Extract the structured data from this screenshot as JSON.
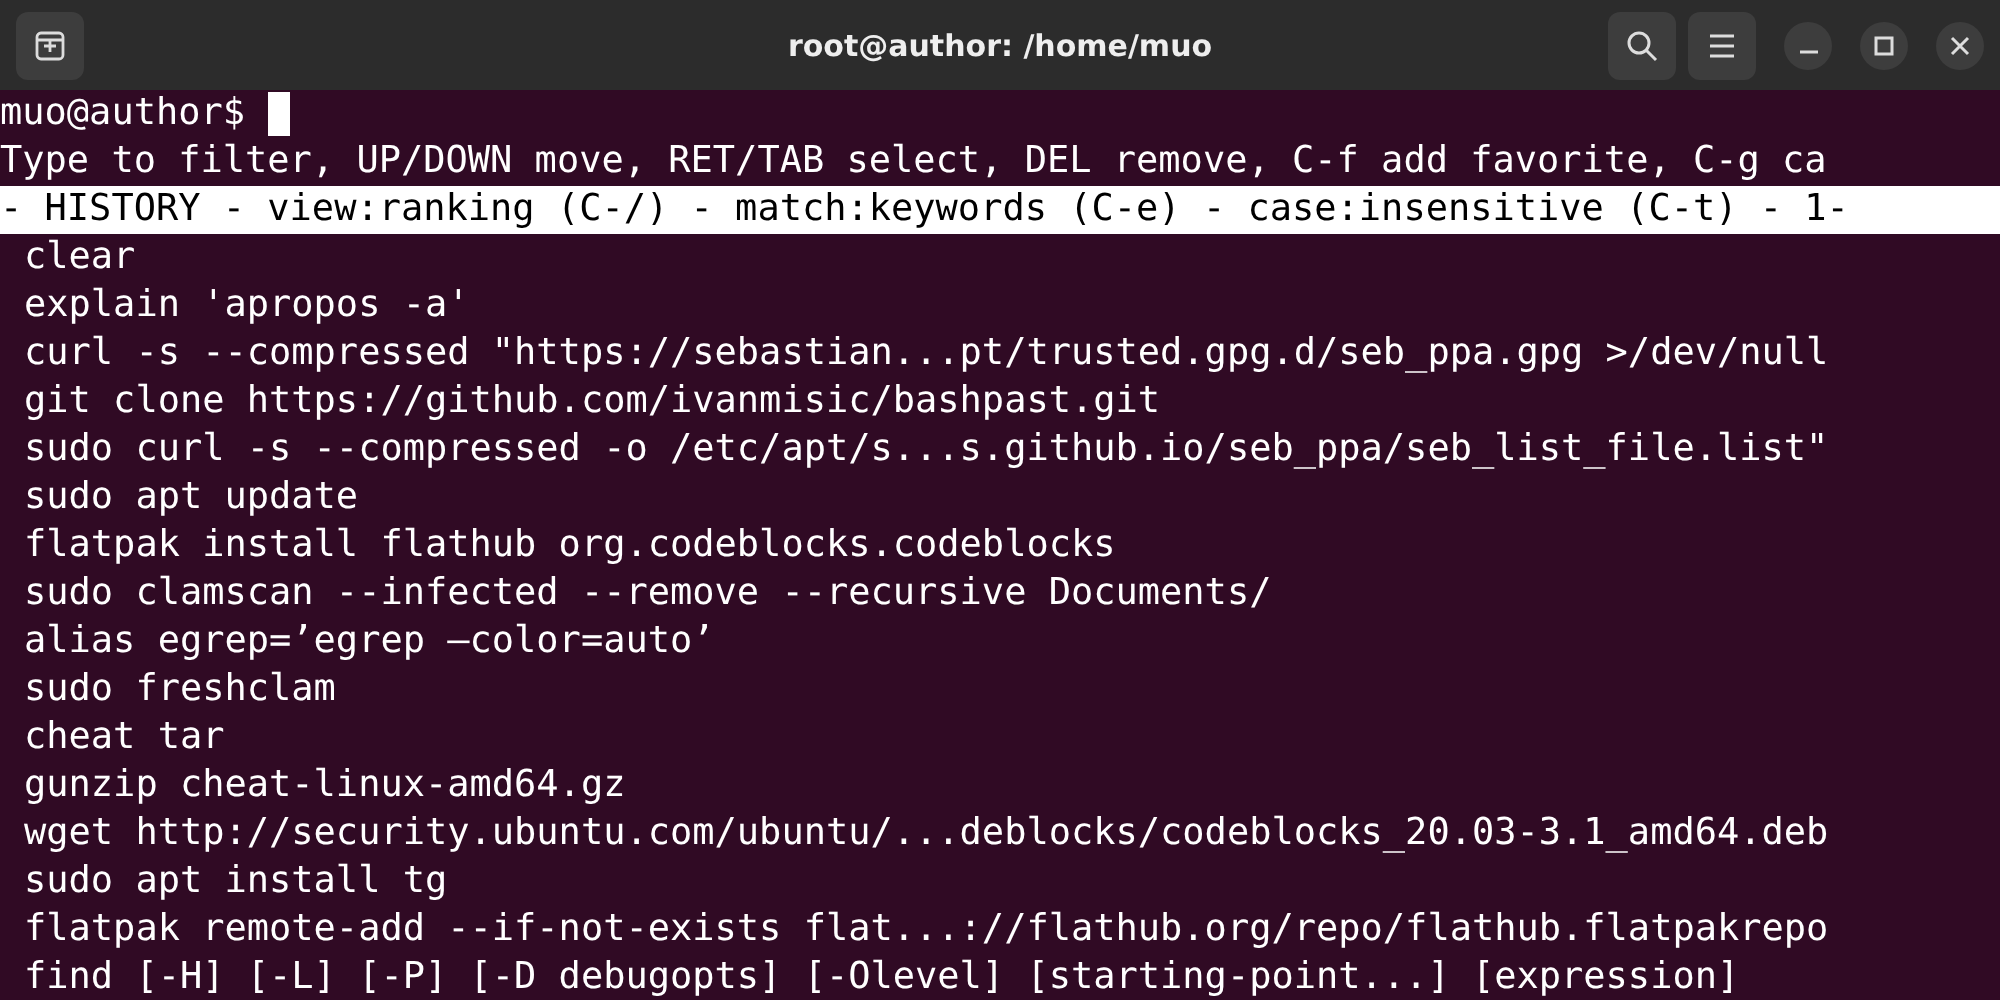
{
  "window": {
    "title": "root@author: /home/muo"
  },
  "prompt": "muo@author$",
  "help_line": "Type to filter, UP/DOWN move, RET/TAB select, DEL remove, C-f add favorite, C-g ca",
  "status_line": "- HISTORY - view:ranking (C-/) - match:keywords (C-e) - case:insensitive (C-t) - 1-",
  "history": [
    "clear",
    "explain 'apropos -a'",
    "curl -s --compressed \"https://sebastian...pt/trusted.gpg.d/seb_ppa.gpg >/dev/null",
    "git clone https://github.com/ivanmisic/bashpast.git",
    "sudo curl -s --compressed -o /etc/apt/s...s.github.io/seb_ppa/seb_list_file.list\"",
    "sudo apt update",
    "flatpak install flathub org.codeblocks.codeblocks",
    "sudo clamscan --infected --remove --recursive Documents/",
    "alias egrep=’egrep —color=auto’",
    "sudo freshclam",
    "cheat tar",
    "gunzip cheat-linux-amd64.gz",
    "wget http://security.ubuntu.com/ubuntu/...deblocks/codeblocks_20.03-3.1_amd64.deb",
    "sudo apt install tg",
    "flatpak remote-add --if-not-exists flat...://flathub.org/repo/flathub.flatpakrepo",
    "find [-H] [-L] [-P] [-D debugopts] [-Olevel] [starting-point...] [expression]"
  ]
}
